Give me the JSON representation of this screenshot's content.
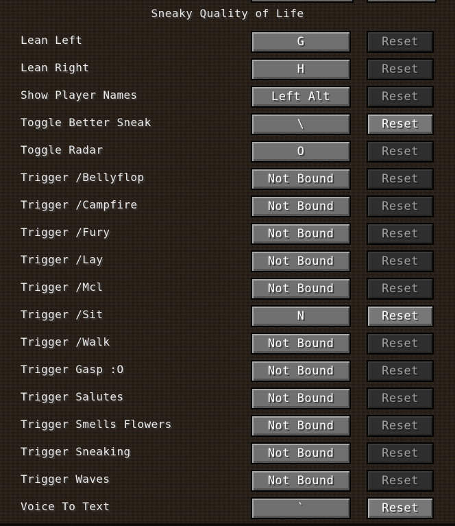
{
  "title": "Sneaky Quality of Life",
  "reset_label": "Reset",
  "rows": [
    {
      "label": "Lean Left",
      "key": "G",
      "reset_enabled": false
    },
    {
      "label": "Lean Right",
      "key": "H",
      "reset_enabled": false
    },
    {
      "label": "Show Player Names",
      "key": "Left Alt",
      "reset_enabled": false
    },
    {
      "label": "Toggle Better Sneak",
      "key": "\\",
      "reset_enabled": true
    },
    {
      "label": "Toggle Radar",
      "key": "O",
      "reset_enabled": false
    },
    {
      "label": "Trigger /Bellyflop",
      "key": "Not Bound",
      "reset_enabled": false
    },
    {
      "label": "Trigger /Campfire",
      "key": "Not Bound",
      "reset_enabled": false
    },
    {
      "label": "Trigger /Fury",
      "key": "Not Bound",
      "reset_enabled": false
    },
    {
      "label": "Trigger /Lay",
      "key": "Not Bound",
      "reset_enabled": false
    },
    {
      "label": "Trigger /Mcl",
      "key": "Not Bound",
      "reset_enabled": false
    },
    {
      "label": "Trigger /Sit",
      "key": "N",
      "reset_enabled": true
    },
    {
      "label": "Trigger /Walk",
      "key": "Not Bound",
      "reset_enabled": false
    },
    {
      "label": "Trigger Gasp :O",
      "key": "Not Bound",
      "reset_enabled": false
    },
    {
      "label": "Trigger Salutes",
      "key": "Not Bound",
      "reset_enabled": false
    },
    {
      "label": "Trigger Smells Flowers",
      "key": "Not Bound",
      "reset_enabled": false
    },
    {
      "label": "Trigger Sneaking",
      "key": "Not Bound",
      "reset_enabled": false
    },
    {
      "label": "Trigger Waves",
      "key": "Not Bound",
      "reset_enabled": false
    },
    {
      "label": "Voice To Text",
      "key": "`",
      "reset_enabled": true
    }
  ]
}
